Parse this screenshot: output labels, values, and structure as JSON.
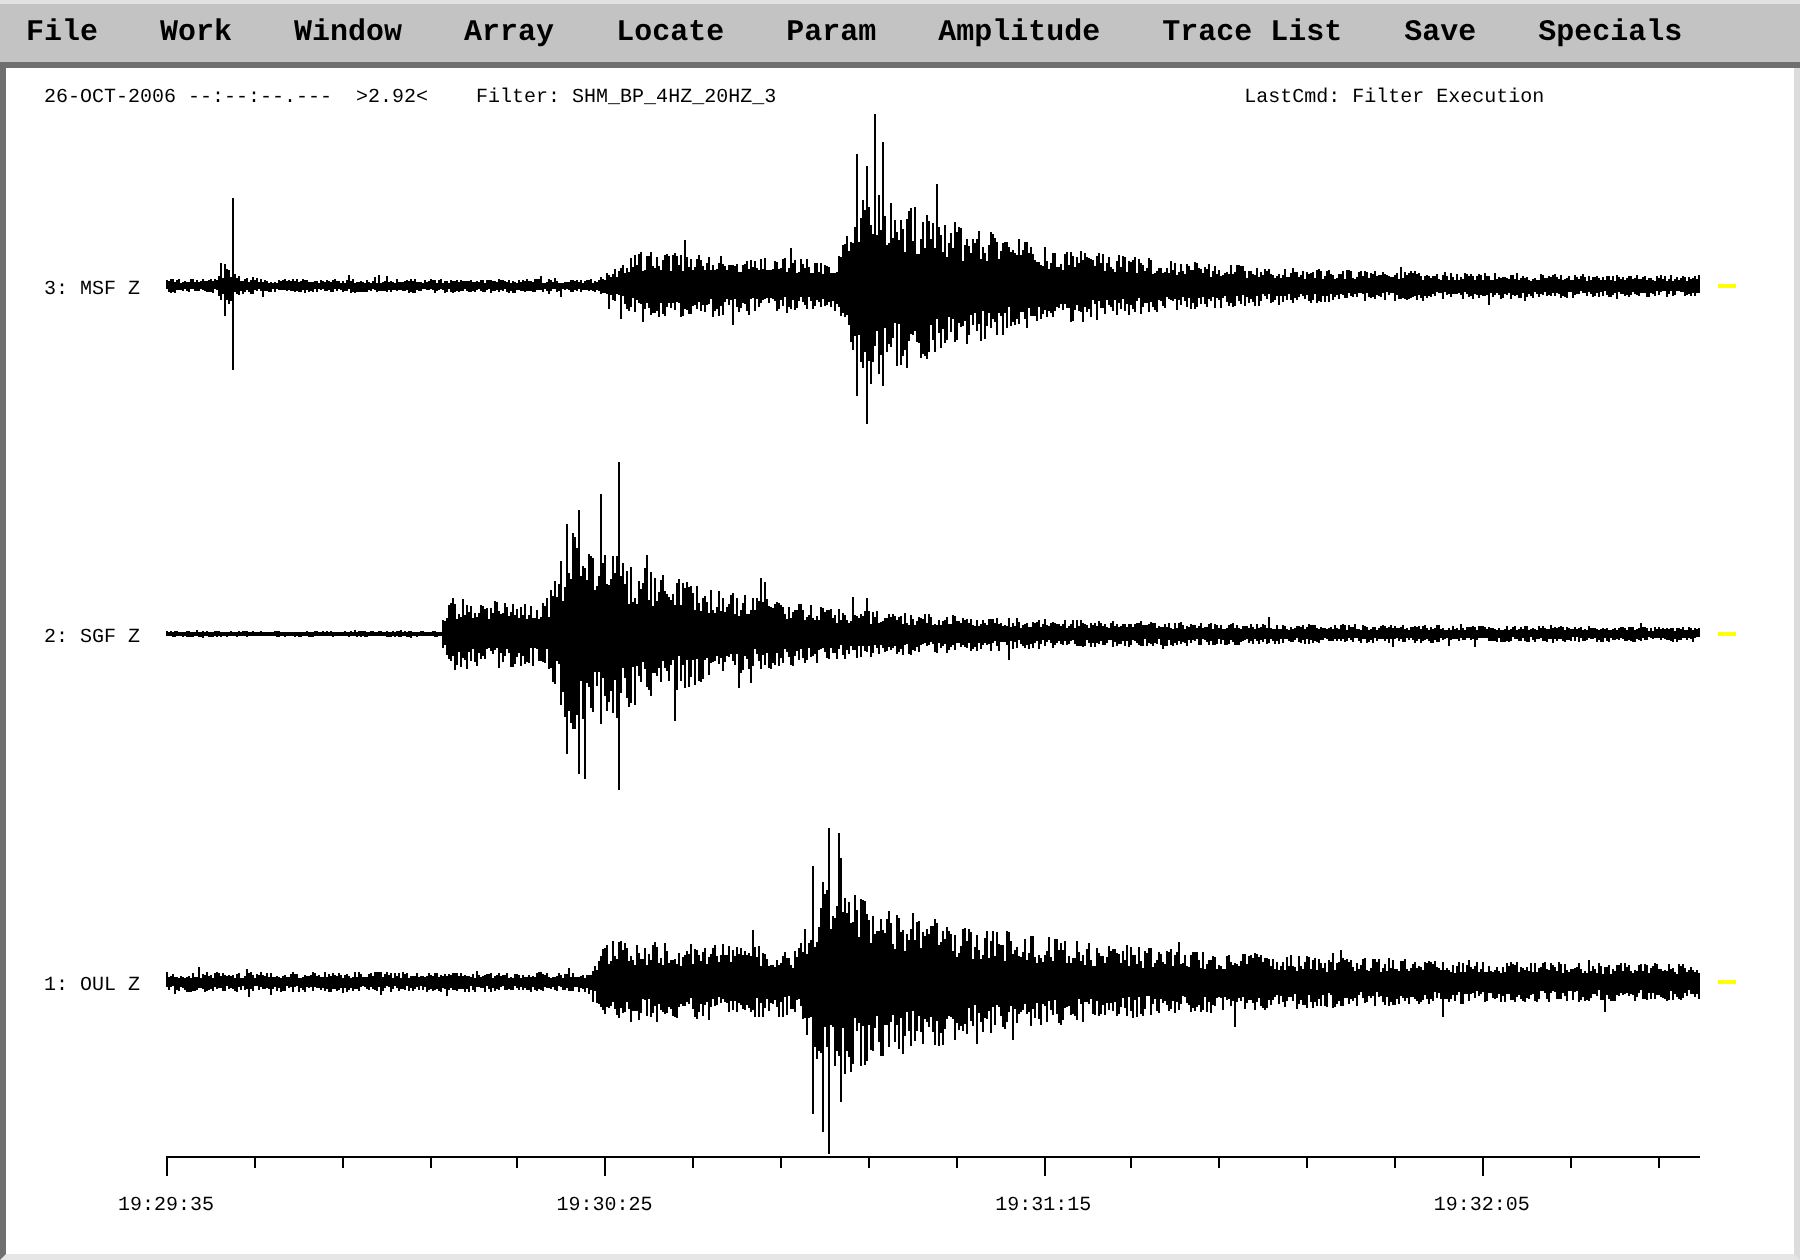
{
  "menu": [
    {
      "label": "File"
    },
    {
      "label": "Work"
    },
    {
      "label": "Window"
    },
    {
      "label": "Array"
    },
    {
      "label": "Locate"
    },
    {
      "label": "Param"
    },
    {
      "label": "Amplitude"
    },
    {
      "label": "Trace List"
    },
    {
      "label": "Save"
    },
    {
      "label": "Specials"
    }
  ],
  "status": {
    "date": "26-OCT-2006",
    "time": "--:--:--.---",
    "scale": ">2.92<",
    "filter": "Filter: SHM_BP_4HZ_20HZ_3",
    "last_command": "LastCmd: Filter Execution"
  },
  "traces": [
    {
      "label": "3: MSF Z"
    },
    {
      "label": "2: SGF Z"
    },
    {
      "label": "1: OUL Z"
    }
  ],
  "time_axis": {
    "labels": [
      "19:29:35",
      "19:30:25",
      "19:31:15",
      "19:32:05"
    ]
  }
}
